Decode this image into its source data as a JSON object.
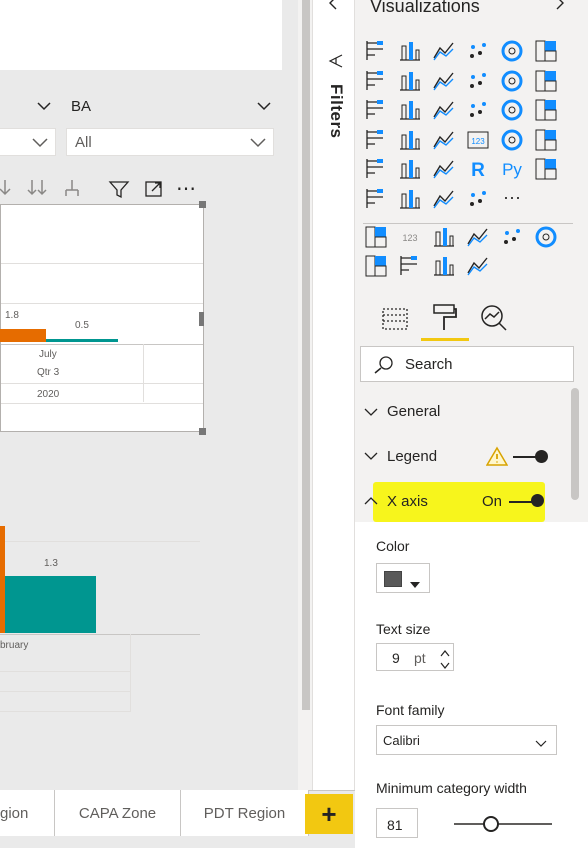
{
  "canvas": {
    "slicer1": {
      "title": "",
      "value": ""
    },
    "slicer2": {
      "title": "BA",
      "value": "All"
    },
    "visual_top": {
      "value_labels": [
        "1.8",
        "0.5"
      ],
      "axis": {
        "month": "July",
        "quarter": "Qtr 3",
        "year": "2020"
      }
    },
    "visual_bottom": {
      "value_labels": [
        "1.3"
      ],
      "axis": {
        "month": "bruary"
      }
    },
    "colors": {
      "series1": "#e66c00",
      "series2": "#009690",
      "card": "#ffffff"
    }
  },
  "filters": {
    "label": "Filters"
  },
  "viz": {
    "title": "Visualizations",
    "icons": [
      "stacked-bar-icon",
      "stacked-column-icon",
      "clustered-bar-icon",
      "clustered-column-icon",
      "100-stacked-bar-icon",
      "100-stacked-column-icon",
      "line-chart-icon",
      "area-chart-icon",
      "stacked-area-icon",
      "line-column-icon",
      "line-clustered-column-icon",
      "ribbon-chart-icon",
      "waterfall-icon",
      "funnel-icon",
      "scatter-icon",
      "pie-icon",
      "donut-icon",
      "treemap-icon",
      "map-icon",
      "filled-map-icon",
      "gauge-icon",
      "card-icon",
      "multi-row-card-icon",
      "kpi-icon",
      "slicer-icon",
      "table-icon",
      "matrix-icon",
      "r-visual-icon",
      "python-visual-icon",
      "key-influencers-icon",
      "decomposition-tree-icon",
      "qa-icon",
      "smart-narrative-icon",
      "power-apps-icon",
      "more-icon",
      "search-visual-icon",
      "number-card-icon",
      "heatmap-icon",
      "star-icon",
      "bullet-icon",
      "custom-visual-icon",
      "gantt-icon",
      "table-heat-icon",
      "bar-heat-icon",
      "timeline-icon"
    ],
    "tabs": [
      "fields-tab-icon",
      "format-tab-icon",
      "analytics-tab-icon"
    ],
    "search_placeholder": "Search",
    "sections": {
      "general": "General",
      "legend": "Legend",
      "xaxis": "X axis",
      "xaxis_state": "On"
    },
    "xaxis": {
      "color_label": "Color",
      "color_value": "#595959",
      "text_size_label": "Text size",
      "text_size_value": "9",
      "text_size_unit": "pt",
      "font_family_label": "Font family",
      "font_family_value": "Calibri",
      "min_width_label": "Minimum category width",
      "min_width_value": "81"
    }
  },
  "pages": {
    "tabs": [
      "gion",
      "CAPA Zone",
      "PDT Region"
    ],
    "add": "+"
  }
}
